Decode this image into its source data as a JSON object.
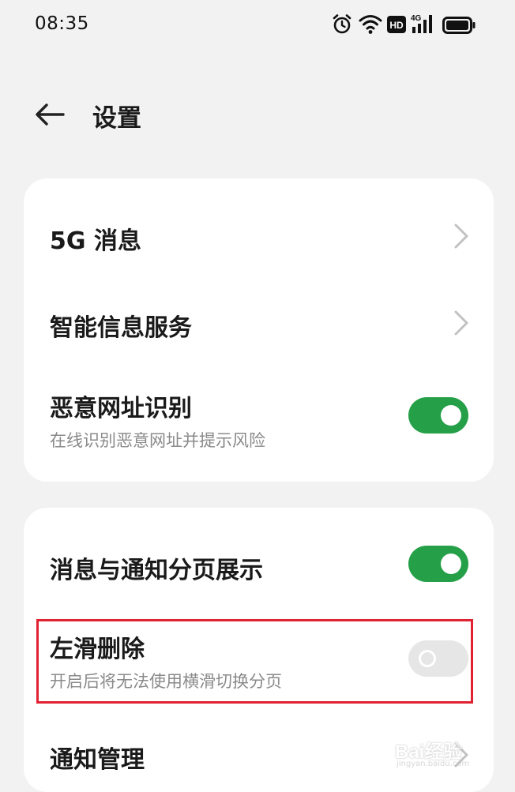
{
  "status_bar": {
    "time": "08:35",
    "icons": [
      "alarm-icon",
      "wifi-icon",
      "hd-icon",
      "4g-signal-icon",
      "battery-icon"
    ],
    "hd_label": "HD",
    "network_label": "4G"
  },
  "header": {
    "back_icon": "back-arrow-icon",
    "title": "设置"
  },
  "cards": [
    {
      "rows": [
        {
          "title": "5G 消息",
          "control": "chevron"
        },
        {
          "title": "智能信息服务",
          "control": "chevron"
        },
        {
          "title": "恶意网址识别",
          "subtitle": "在线识别恶意网址并提示风险",
          "control": "toggle",
          "toggle_on": true
        }
      ]
    },
    {
      "rows": [
        {
          "title": "消息与通知分页展示",
          "control": "toggle",
          "toggle_on": true
        },
        {
          "title": "左滑删除",
          "subtitle": "开启后将无法使用横滑切换分页",
          "control": "toggle",
          "toggle_on": false,
          "highlighted": true
        },
        {
          "title": "通知管理",
          "control": "chevron"
        }
      ]
    }
  ],
  "colors": {
    "accent_green": "#25a048",
    "background": "#f2f2f2",
    "card": "#ffffff",
    "highlight_red": "#e02233"
  },
  "watermark": {
    "brand": "Bai经验",
    "url": "jingyan.baidu.com"
  }
}
